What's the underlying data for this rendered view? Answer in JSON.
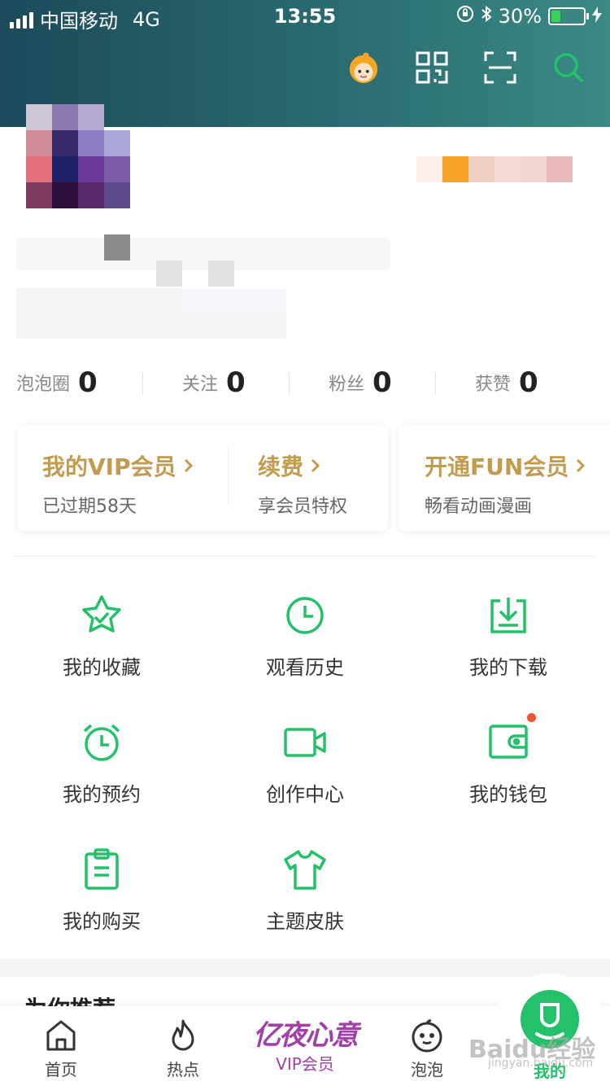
{
  "status_bar": {
    "carrier": "中国移动",
    "network": "4G",
    "time": "13:55",
    "battery": "30%",
    "battery_level": 0.3
  },
  "header_icons": [
    "mascot-avatar-icon",
    "qr-code-icon",
    "scan-icon",
    "search-icon"
  ],
  "stats": [
    {
      "label": "泡泡圈",
      "value": "0"
    },
    {
      "label": "关注",
      "value": "0"
    },
    {
      "label": "粉丝",
      "value": "0"
    },
    {
      "label": "获赞",
      "value": "0"
    }
  ],
  "vip": {
    "my_vip_title": "我的VIP会员",
    "my_vip_sub": "已过期58天",
    "renew_title": "续费",
    "renew_sub": "享会员特权",
    "fun_title": "开通FUN会员",
    "fun_sub": "畅看动画漫画"
  },
  "menu": [
    {
      "label": "我的收藏",
      "icon": "star-icon"
    },
    {
      "label": "观看历史",
      "icon": "clock-icon"
    },
    {
      "label": "我的下载",
      "icon": "download-icon"
    },
    {
      "label": "我的预约",
      "icon": "alarm-clock-icon"
    },
    {
      "label": "创作中心",
      "icon": "video-camera-icon"
    },
    {
      "label": "我的钱包",
      "icon": "wallet-icon"
    },
    {
      "label": "我的购买",
      "icon": "clipboard-icon"
    },
    {
      "label": "主题皮肤",
      "icon": "tshirt-icon"
    }
  ],
  "section_title": "为你推荐",
  "bottom_nav": [
    {
      "label": "首页",
      "icon": "home-icon"
    },
    {
      "label": "热点",
      "icon": "flame-icon"
    },
    {
      "label": "VIP会员",
      "icon": "vip-logo",
      "logo_text": "亿夜心意"
    },
    {
      "label": "泡泡",
      "icon": "bubble-face-icon"
    },
    {
      "label": "我的",
      "icon": "mine-face-icon"
    }
  ],
  "watermark": {
    "text": "Baidu经验",
    "sub": "jingyan.baidu.com"
  },
  "colors": {
    "accent": "#22c16a",
    "vip_gold": "#c39b4f",
    "header_start": "#1c4a5a",
    "header_end": "#3b8a84",
    "notify_dot": "#f0562d"
  }
}
